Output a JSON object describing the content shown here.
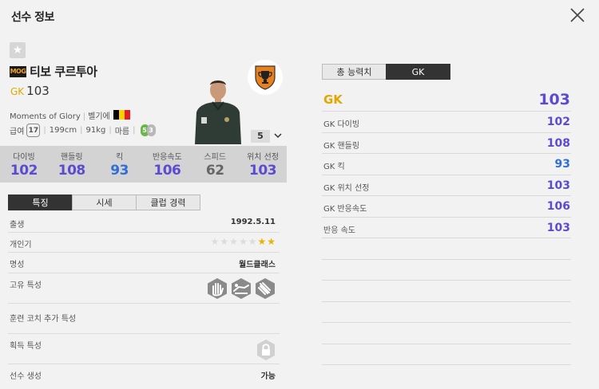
{
  "window": {
    "title": "선수 정보"
  },
  "player": {
    "season_badge": "MOG",
    "name": "티보 쿠르투아",
    "position": "GK",
    "ovr": "103",
    "season_name": "Moments of Glory",
    "nation": "벨기에",
    "salary_label": "급여",
    "salary": "17",
    "height": "199cm",
    "weight": "91kg",
    "body_type": "마름",
    "foot_main": "5",
    "foot_sub": "3",
    "upgrade_level": "5"
  },
  "stats": [
    {
      "label": "다이빙",
      "value": "102",
      "color": "#5a4bd1"
    },
    {
      "label": "핸들링",
      "value": "108",
      "color": "#5a4bd1"
    },
    {
      "label": "킥",
      "value": "93",
      "color": "#2f6fd6"
    },
    {
      "label": "반응속도",
      "value": "106",
      "color": "#5a4bd1"
    },
    {
      "label": "스피드",
      "value": "62",
      "color": "#666666"
    },
    {
      "label": "위치 선정",
      "value": "103",
      "color": "#5a4bd1"
    }
  ],
  "tabs": [
    "특징",
    "시세",
    "클럽 경력"
  ],
  "details": {
    "birth_label": "출생",
    "birth_value": "1992.5.11",
    "skill_label": "개인기",
    "skill_stars_filled": 2,
    "skill_stars_total": 7,
    "reputation_label": "명성",
    "reputation_value": "월드클래스",
    "traits_label": "고유 특성",
    "coach_label": "훈련 코치 추가 특성",
    "acquired_label": "획득 특성",
    "create_label": "선수 생성",
    "create_value": "가능"
  },
  "right_tabs": [
    "총 능력치",
    "GK"
  ],
  "right_list": [
    {
      "label": "GK",
      "value": "103",
      "color": "#5a4bd1"
    },
    {
      "label": "GK 다이빙",
      "value": "102",
      "color": "#5a4bd1"
    },
    {
      "label": "GK 핸들링",
      "value": "108",
      "color": "#5a4bd1"
    },
    {
      "label": "GK 킥",
      "value": "93",
      "color": "#2f6fd6"
    },
    {
      "label": "GK 위치 선정",
      "value": "103",
      "color": "#5a4bd1"
    },
    {
      "label": "GK 반응속도",
      "value": "106",
      "color": "#5a4bd1"
    },
    {
      "label": "반응 속도",
      "value": "103",
      "color": "#5a4bd1"
    }
  ],
  "icons": {
    "close": "close-icon",
    "favorite": "star-icon",
    "club": "club-emblem-icon",
    "lock": "lock-icon"
  }
}
